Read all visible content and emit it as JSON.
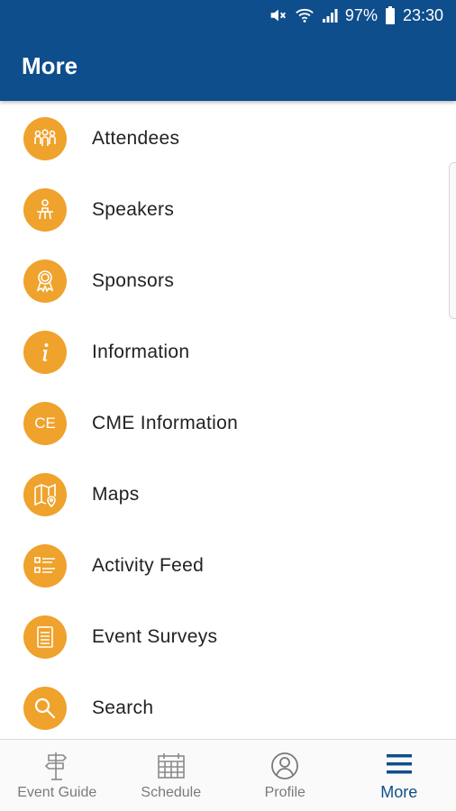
{
  "status": {
    "battery": "97%",
    "time": "23:30"
  },
  "appbar": {
    "title": "More"
  },
  "menu": [
    {
      "label": "Attendees",
      "icon": "attendees-icon"
    },
    {
      "label": "Speakers",
      "icon": "speaker-icon"
    },
    {
      "label": "Sponsors",
      "icon": "ribbon-icon"
    },
    {
      "label": "Information",
      "icon": "info-icon"
    },
    {
      "label": "CME Information",
      "icon": "ce-icon",
      "icon_text": "CE"
    },
    {
      "label": "Maps",
      "icon": "map-icon"
    },
    {
      "label": "Activity Feed",
      "icon": "list-icon"
    },
    {
      "label": "Event Surveys",
      "icon": "clipboard-icon"
    },
    {
      "label": "Search",
      "icon": "search-icon"
    }
  ],
  "bottom_nav": [
    {
      "label": "Event Guide",
      "icon": "signpost-icon"
    },
    {
      "label": "Schedule",
      "icon": "calendar-icon"
    },
    {
      "label": "Profile",
      "icon": "profile-icon"
    },
    {
      "label": "More",
      "icon": "menu-icon",
      "active": true
    }
  ],
  "colors": {
    "primary": "#0f4e8c",
    "accent": "#efa22c"
  }
}
